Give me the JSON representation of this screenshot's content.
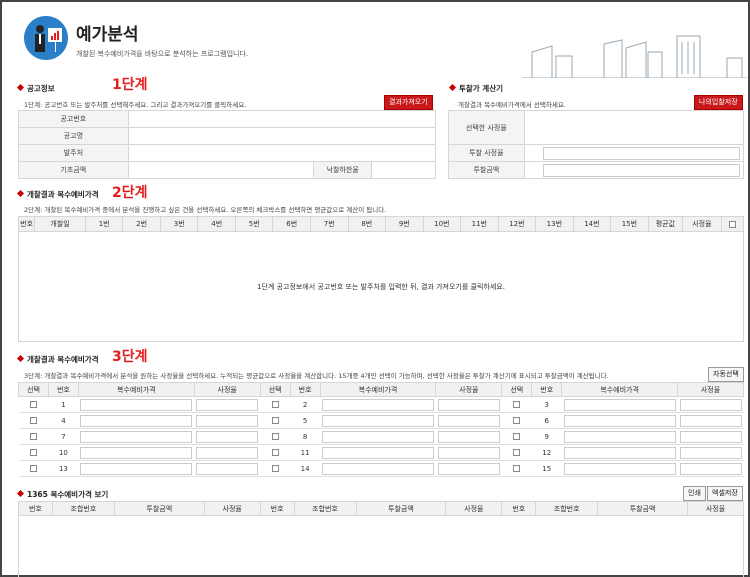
{
  "header": {
    "title": "예가분석",
    "subtitle": "개찰된 복수예비가격을 바탕으로 분석하는 프로그램입니다."
  },
  "section1": {
    "title": "공고정보",
    "step": "1단계",
    "desc": "1단계: 공고번호 또는 발주처를 선택해주세요. 그리고 결과가져오기를 클릭하세요.",
    "button": "결과가져오기",
    "labels": {
      "notice_no": "공고번호",
      "notice_name": "공고명",
      "client": "발주처",
      "base_amount": "기초금액",
      "lower_rate": "낙찰하한율"
    }
  },
  "calc": {
    "title": "투찰가 계산기",
    "desc": "개찰결과 복수예비가격에서 선택하세요.",
    "button": "나의입찰저장",
    "labels": {
      "selected_rate": "선택한 사정율",
      "bid_rate": "투찰 사정율",
      "bid_amount": "투찰금액"
    }
  },
  "section2": {
    "title": "개찰결과 복수예비가격",
    "step": "2단계",
    "desc": "2단계: 개찰된 복수예비가격 중에서 분석을 진행하고 싶은 건을 선택하세요. 오른쪽의 체크박스를 선택하면 평균값으로 계산이 됩니다.",
    "headers": [
      "번호",
      "개찰일",
      "1번",
      "2번",
      "3번",
      "4번",
      "5번",
      "6번",
      "7번",
      "8번",
      "9번",
      "10번",
      "11번",
      "12번",
      "13번",
      "14번",
      "15번",
      "평균값",
      "사정율"
    ],
    "empty_message": "1단계 공고정보에서 공고번호 또는 발주처를 입력한 뒤, 결과 가져오기를 클릭하세요."
  },
  "section3": {
    "title": "개찰결과 복수예비가격",
    "step": "3단계",
    "desc": "3단계: 개찰결과 복수예비가격에서 분석을 원하는 사정율을 선택하세요. 누적되는 평균값으로 사정율을 계산합니다. 15개중 4개만 선택이 가능하며, 선택한 사정율은 투찰가 계산기에 표시되고 투찰금액이 계산됩니다.",
    "button": "자동선택",
    "headers": [
      "선택",
      "번호",
      "복수예비가격",
      "사정율"
    ],
    "rows": [
      [
        "1",
        "2",
        "3"
      ],
      [
        "4",
        "5",
        "6"
      ],
      [
        "7",
        "8",
        "9"
      ],
      [
        "10",
        "11",
        "12"
      ],
      [
        "13",
        "14",
        "15"
      ]
    ]
  },
  "section4": {
    "title": "1365 복수예비가격 보기",
    "print_button": "인쇄",
    "excel_button": "엑셀저장",
    "headers": [
      "번호",
      "조합번호",
      "투찰금액",
      "사정율"
    ]
  }
}
